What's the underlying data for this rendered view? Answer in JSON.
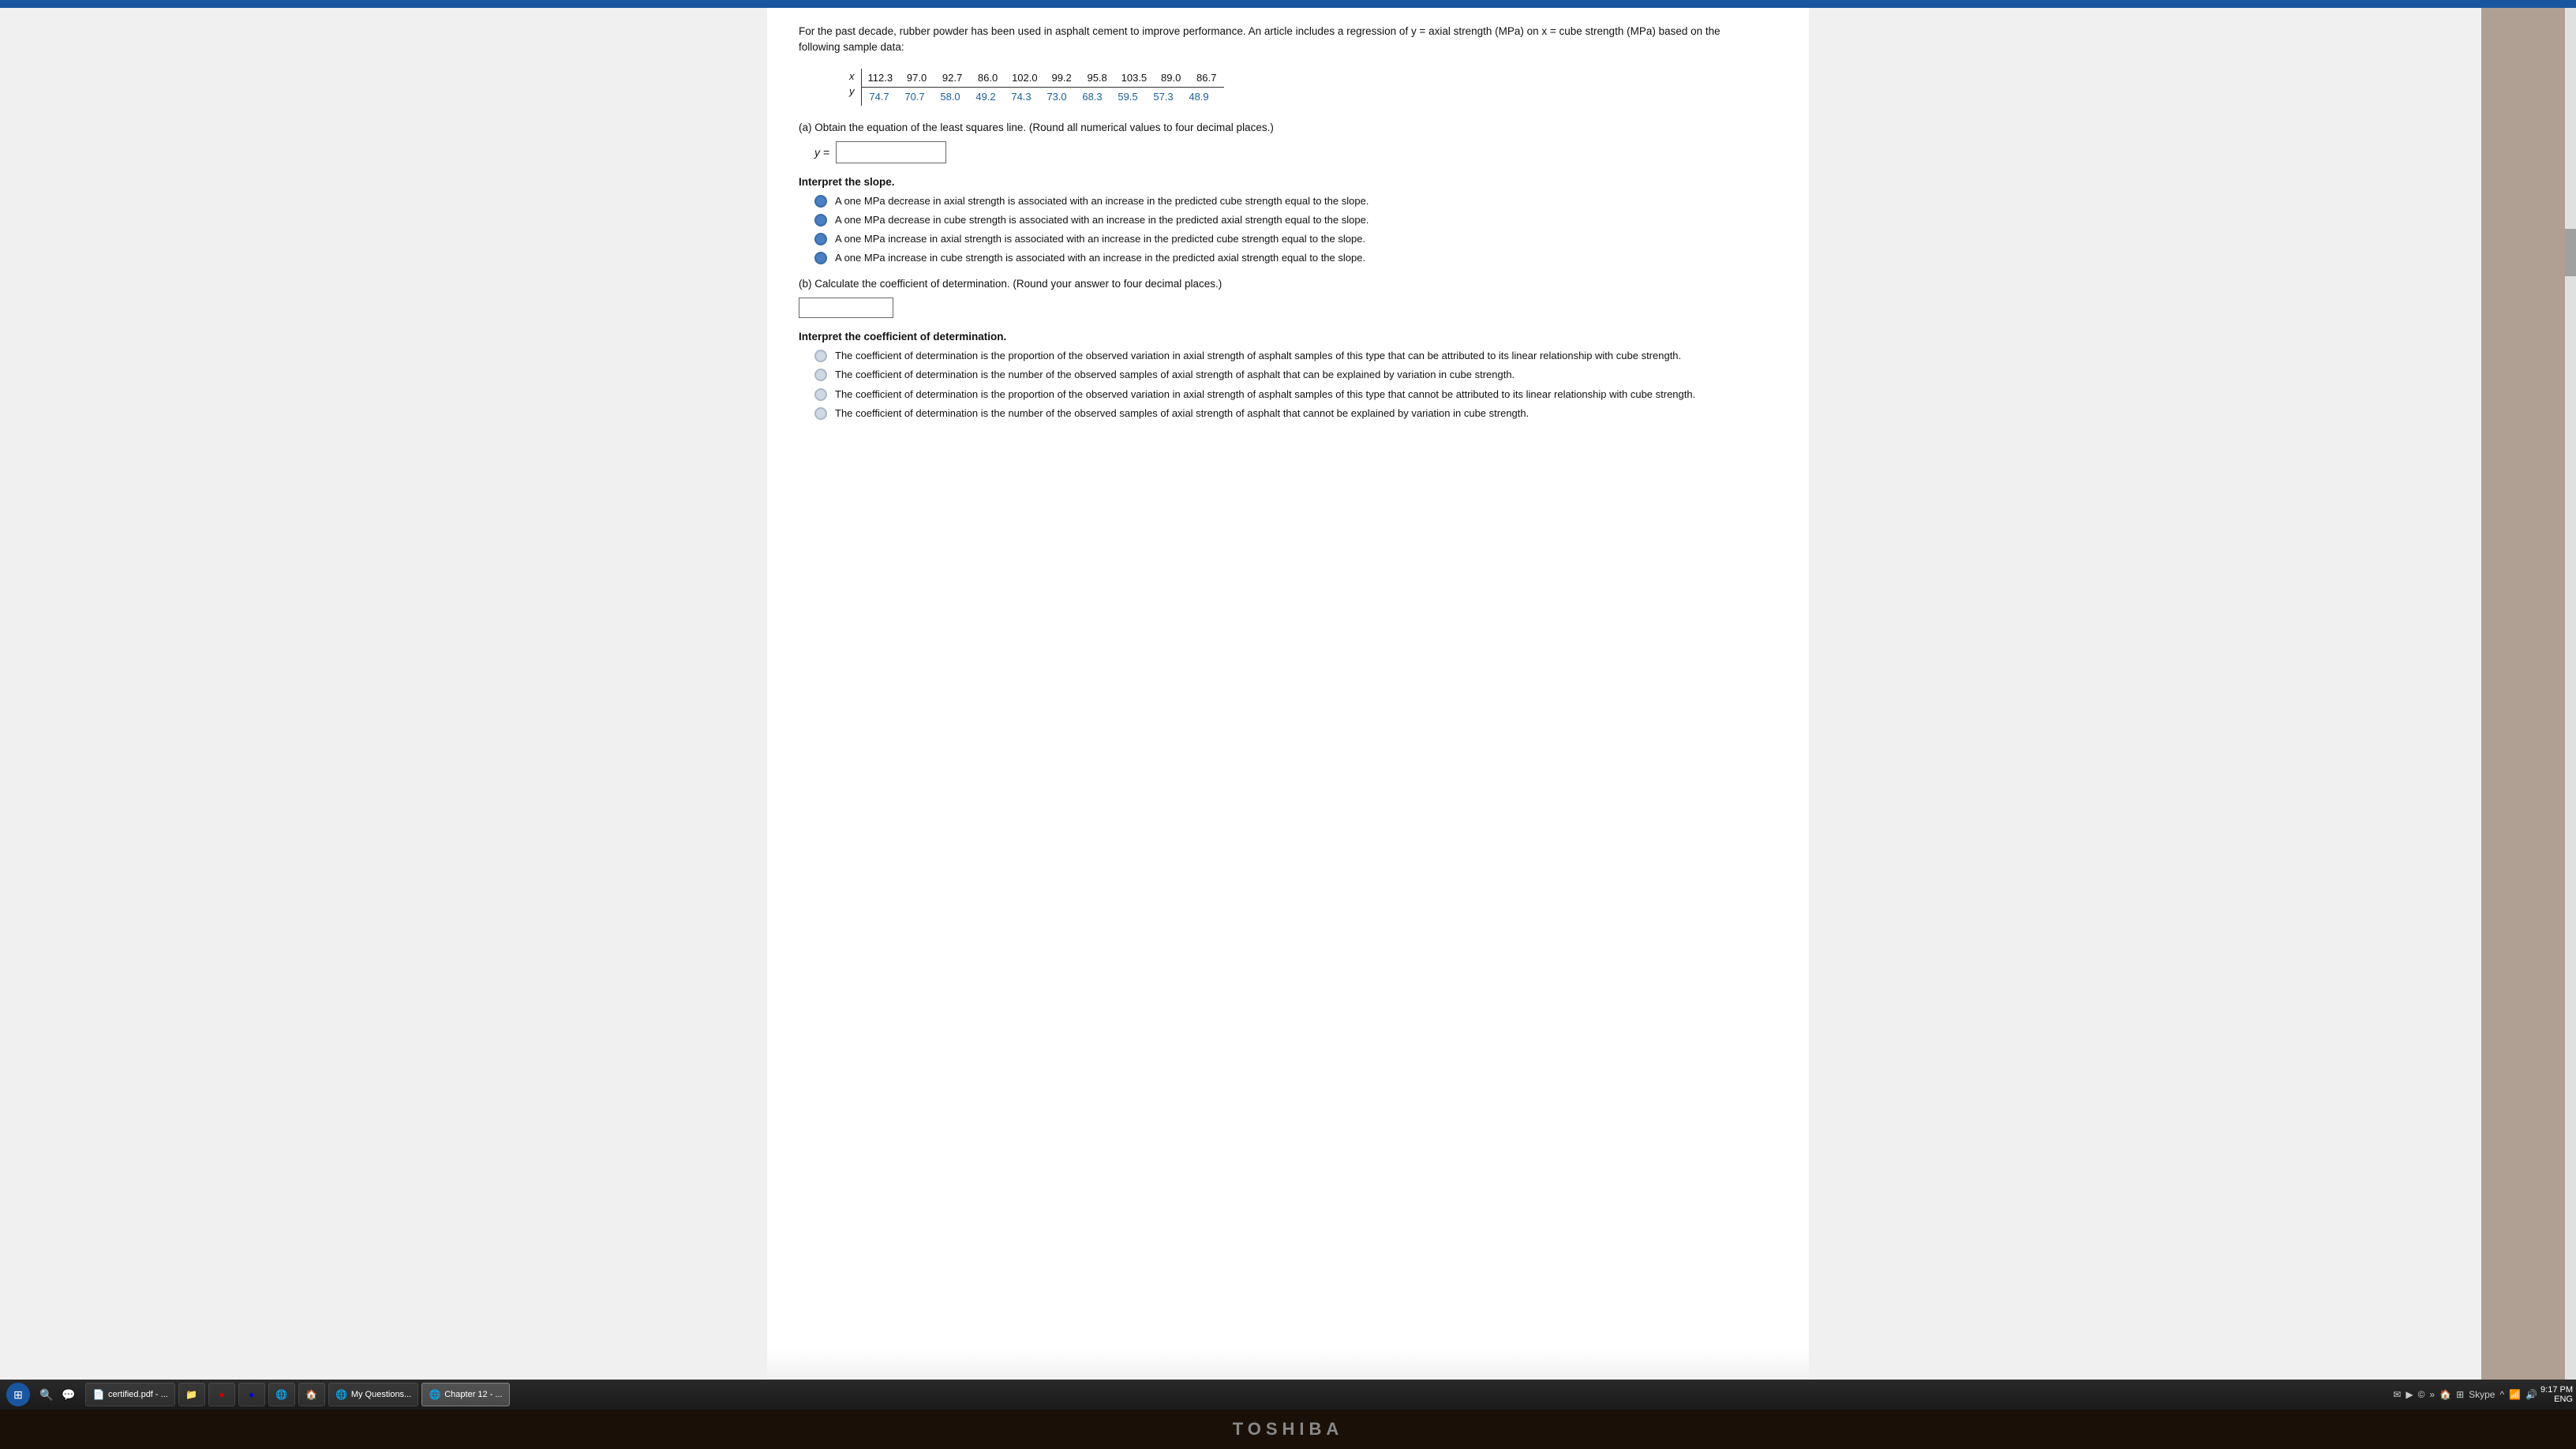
{
  "topbar": {
    "color": "#1a56a0"
  },
  "document": {
    "intro": "For the past decade, rubber powder has been used in asphalt cement to improve performance. An article includes a regression of y = axial strength (MPa) on x = cube strength (MPa) based on the following sample data:",
    "table": {
      "x_label": "x",
      "y_label": "y",
      "x_values": [
        "112.3",
        "97.0",
        "92.7",
        "86.0",
        "102.0",
        "99.2",
        "95.8",
        "103.5",
        "89.0",
        "86.7"
      ],
      "y_values": [
        "74.7",
        "70.7",
        "58.0",
        "49.2",
        "74.3",
        "73.0",
        "68.3",
        "59.5",
        "57.3",
        "48.9"
      ]
    },
    "part_a": {
      "heading": "(a) Obtain the equation of the least squares line. (Round all numerical values to four decimal places.)",
      "equation_label": "y =",
      "equation_placeholder": "",
      "slope_heading": "Interpret the slope.",
      "slope_options": [
        "A one MPa decrease in axial strength is associated with an increase in the predicted cube strength equal to the slope.",
        "A one MPa decrease in cube strength is associated with an increase in the predicted axial strength equal to the slope.",
        "A one MPa increase in axial strength is associated with an increase in the predicted cube strength equal to the slope.",
        "A one MPa increase in cube strength is associated with an increase in the predicted axial strength equal to the slope."
      ]
    },
    "part_b": {
      "heading": "(b) Calculate the coefficient of determination. (Round your answer to four decimal places.)",
      "interpret_heading": "Interpret the coefficient of determination.",
      "interpret_options": [
        "The coefficient of determination is the proportion of the observed variation in axial strength of asphalt samples of this type that can be attributed to its linear relationship with cube strength.",
        "The coefficient of determination is the number of the observed samples of axial strength of asphalt that can be explained by variation in cube strength.",
        "The coefficient of determination is the proportion of the observed variation in axial strength of asphalt samples of this type that cannot be attributed to its linear relationship with cube strength.",
        "The coefficient of determination is the number of the observed samples of axial strength of asphalt that cannot be explained by variation in cube strength."
      ]
    }
  },
  "taskbar": {
    "start_icon": "⊞",
    "buttons": [
      {
        "label": "certified.pdf - ...",
        "active": false,
        "icon": "📄"
      },
      {
        "label": "",
        "active": false,
        "icon": "📁"
      },
      {
        "label": "",
        "active": false,
        "icon": "🔴"
      },
      {
        "label": "",
        "active": false,
        "icon": "🔵"
      },
      {
        "label": "",
        "active": false,
        "icon": "🔷"
      },
      {
        "label": "",
        "active": false,
        "icon": "🔷"
      },
      {
        "label": "",
        "active": false,
        "icon": "🌐"
      },
      {
        "label": "",
        "active": false,
        "icon": "🏠"
      },
      {
        "label": "My Questions...",
        "active": false,
        "icon": "🌐"
      },
      {
        "label": "Chapter 12 - ...",
        "active": true,
        "icon": "🌐"
      }
    ],
    "tray_icons": [
      "✉",
      "▶",
      "©",
      "»",
      "🏠",
      "Skype"
    ],
    "time": "9:17 PM",
    "lang": "ENG"
  },
  "toshiba": {
    "brand": "TOSHIBA"
  }
}
